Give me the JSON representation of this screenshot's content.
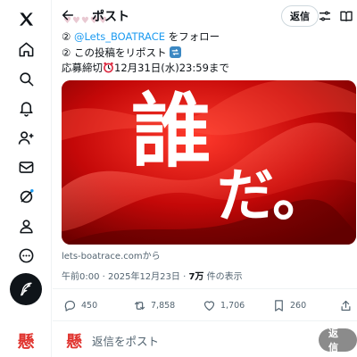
{
  "nav": {
    "items": [
      {
        "icon": "x-logo-icon"
      },
      {
        "icon": "home-icon"
      },
      {
        "icon": "search-icon"
      },
      {
        "icon": "bell-icon"
      },
      {
        "icon": "people-icon"
      },
      {
        "icon": "mail-icon"
      },
      {
        "icon": "grok-icon"
      },
      {
        "icon": "profile-icon"
      },
      {
        "icon": "more-icon"
      }
    ],
    "compose_icon": "feather-icon",
    "avatar_text": "懸",
    "avatar_color": "#e0342f"
  },
  "header": {
    "faded_text": "♥♥♥♥♥",
    "title": "ポスト",
    "reply_label": "返信"
  },
  "post": {
    "line1_prefix": "②",
    "line1_mention": "@Lets_BOATRACE",
    "line1_suffix": " をフォロー",
    "line2": "② この投稿をリポスト",
    "line3_prefix": "応募締切",
    "line3_suffix": "12月31日(水)23:59まで",
    "media_text_1": "誰",
    "media_text_2": "だ。",
    "source": "lets-boatrace.comから",
    "time": "午前0:00 · 2025年12月23日 · ",
    "views_count": "7万",
    "views_label": " 件の表示"
  },
  "actions": {
    "replies": "450",
    "reposts": "7,858",
    "likes": "1,706",
    "bookmarks": "260"
  },
  "reply_box": {
    "avatar_text": "懸",
    "placeholder": "返信をポスト",
    "button_label": "返信"
  },
  "colors": {
    "accent": "#1d9bf0",
    "text": "#0f1419",
    "muted": "#536471",
    "media_red": "#b00000",
    "reply_button": "#8b8b8b"
  }
}
